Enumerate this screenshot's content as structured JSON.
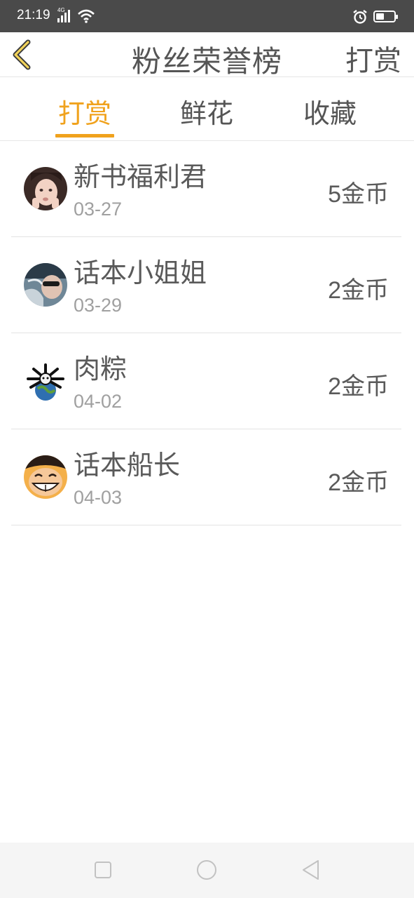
{
  "status_bar": {
    "time": "21:19",
    "network": "4G",
    "battery_level": 0.45,
    "icons": [
      "signal-icon",
      "wifi-icon",
      "alarm-icon",
      "battery-icon"
    ]
  },
  "header": {
    "back_icon": "chevron-left-icon",
    "title": "粉丝荣誉榜",
    "action_label": "打赏"
  },
  "tabs": [
    {
      "label": "打赏",
      "active": true
    },
    {
      "label": "鲜花",
      "active": false
    },
    {
      "label": "收藏",
      "active": false
    }
  ],
  "list": [
    {
      "name": "新书福利君",
      "date": "03-27",
      "amount": "5",
      "unit": "金币"
    },
    {
      "name": "话本小姐姐",
      "date": "03-29",
      "amount": "2",
      "unit": "金币"
    },
    {
      "name": "肉粽",
      "date": "04-02",
      "amount": "2",
      "unit": "金币"
    },
    {
      "name": "话本船长",
      "date": "04-03",
      "amount": "2",
      "unit": "金币"
    }
  ],
  "nav_bar": {
    "icons": [
      "recent-apps-icon",
      "home-icon",
      "back-icon"
    ]
  },
  "colors": {
    "accent": "#f0a21d",
    "status_bar": "#4a4a4a",
    "text": "#555555",
    "subtext": "#a0a0a0"
  }
}
